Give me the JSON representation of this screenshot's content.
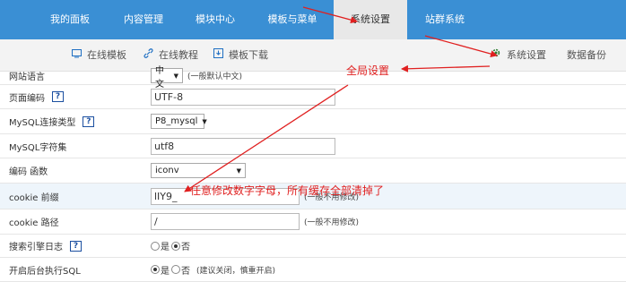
{
  "topnav": {
    "items": [
      "我的面板",
      "内容管理",
      "模块中心",
      "模板与菜单",
      "系统设置",
      "站群系统"
    ],
    "active": "系统设置"
  },
  "subnav": {
    "left": [
      "在线模板",
      "在线教程",
      "模板下载"
    ],
    "right": [
      "系统设置",
      "数据备份"
    ]
  },
  "form": {
    "language": {
      "label": "网站语言",
      "value": "中文",
      "note": "(一般默认中文)"
    },
    "page_encoding": {
      "label": "页面编码",
      "help": "?",
      "value": "UTF-8"
    },
    "mysql_type": {
      "label": "MySQL连接类型",
      "help": "?",
      "value": "P8_mysql"
    },
    "mysql_charset": {
      "label": "MySQL字符集",
      "value": "utf8"
    },
    "encode_func": {
      "label": "编码 函数",
      "value": "iconv"
    },
    "cookie_prefix": {
      "label": "cookie 前缀",
      "value": "lIY9_",
      "note": "(一般不用修改)"
    },
    "cookie_path": {
      "label": "cookie 路径",
      "value": "/",
      "note": "(一般不用修改)"
    },
    "search_log": {
      "label": "搜索引擎日志",
      "help": "?",
      "options": [
        "是",
        "否"
      ],
      "selected": "否"
    },
    "bg_sql": {
      "label": "开启后台执行SQL",
      "options": [
        "是",
        "否"
      ],
      "selected": "是",
      "note": "(建议关闭，慎重开启)"
    }
  },
  "annotations": {
    "global": "全局设置",
    "cookie": "任意修改数字字母，所有缓存全部清掉了"
  },
  "colors": {
    "nav_blue": "#3a8fd4",
    "annotation_red": "#e02020"
  }
}
